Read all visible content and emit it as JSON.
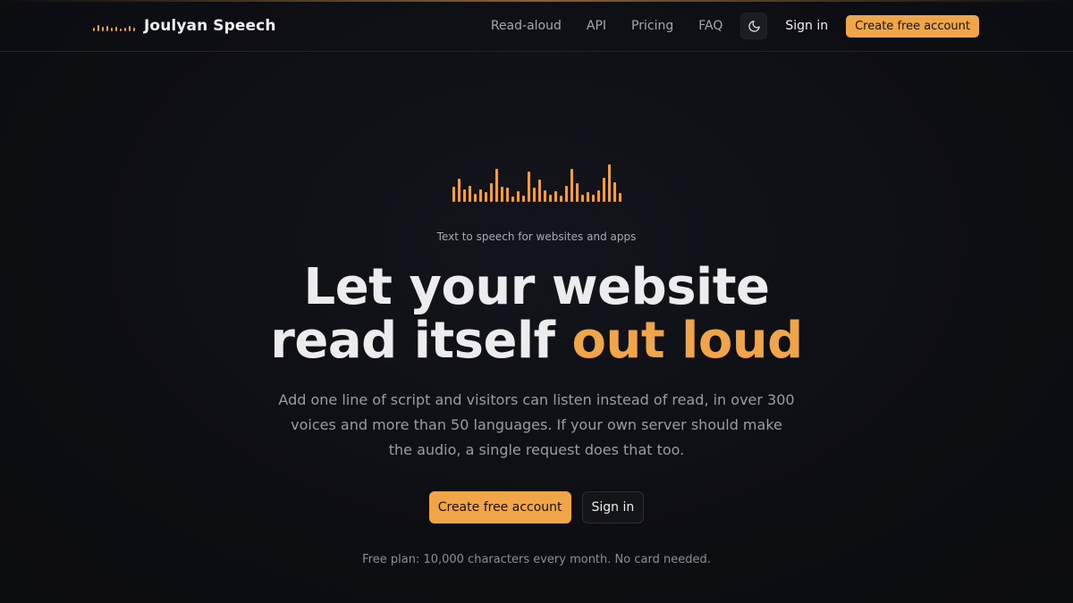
{
  "header": {
    "brand_name": "Joulyan Speech",
    "nav": [
      "Read-aloud",
      "API",
      "Pricing",
      "FAQ"
    ],
    "theme_icon": "moon-icon",
    "sign_in": "Sign in",
    "create_account": "Create free account"
  },
  "hero": {
    "eyebrow": "Text to speech for websites and apps",
    "title_line1": "Let your website",
    "title_line2_plain": "read itself ",
    "title_line2_accent": "out loud",
    "lede": "Add one line of script and visitors can listen instead of read, in over 300 voices and more than 50 languages. If your own server should make the audio, a single request does that too.",
    "primary_cta": "Create free account",
    "secondary_cta": "Sign in",
    "footnote": "Free plan: 10,000 characters every month. No card needed."
  },
  "colors": {
    "accent": "#f0a648",
    "background": "#0d0e13",
    "text": "#ececef",
    "muted": "#9a9ca5"
  }
}
